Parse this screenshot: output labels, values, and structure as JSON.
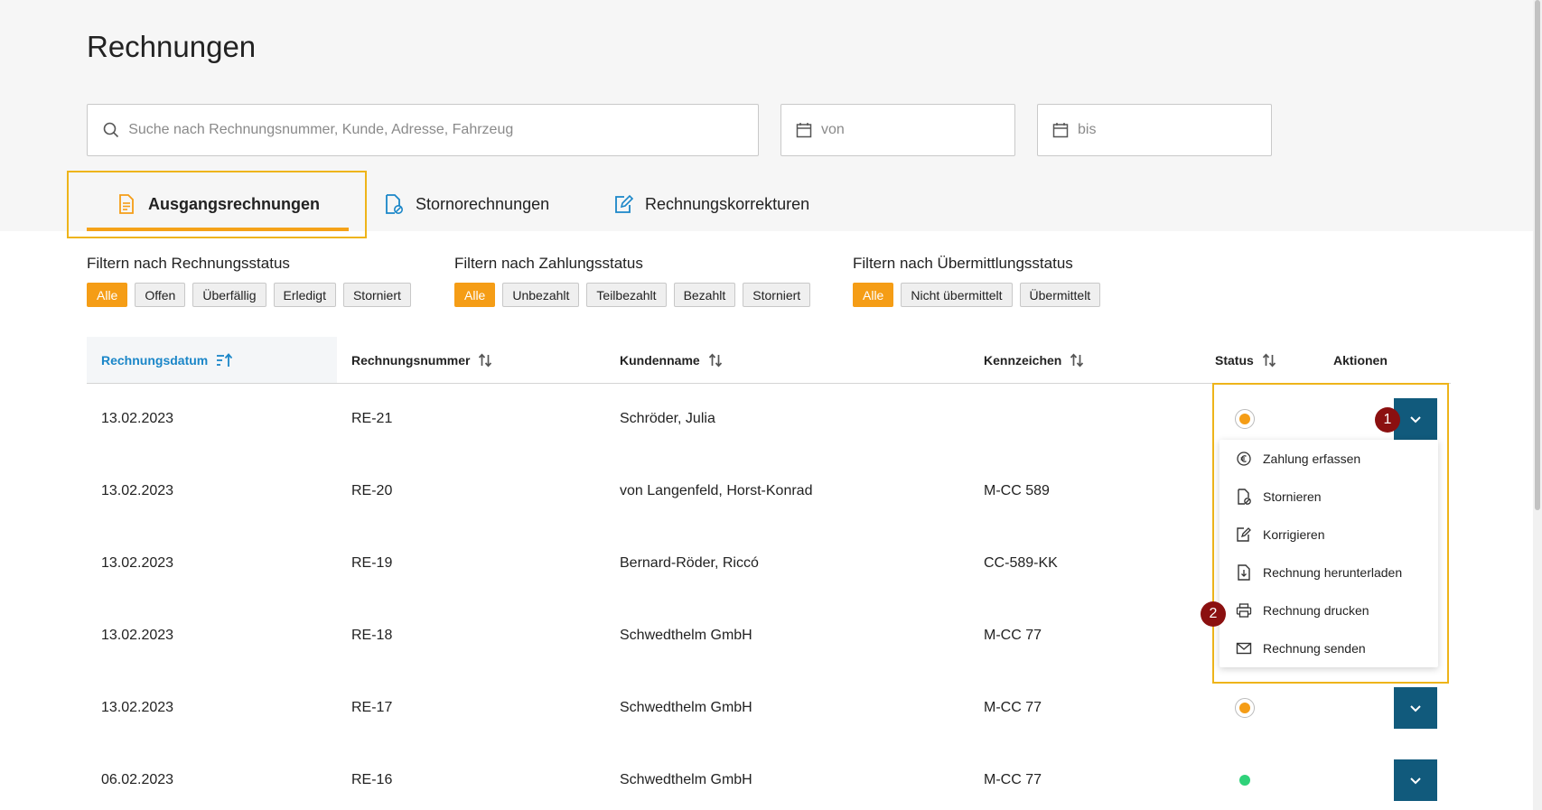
{
  "page": {
    "title": "Rechnungen"
  },
  "search": {
    "placeholder": "Suche nach Rechnungsnummer, Kunde, Adresse, Fahrzeug",
    "date_from_placeholder": "von",
    "date_to_placeholder": "bis"
  },
  "tabs": [
    {
      "label": "Ausgangsrechnungen",
      "icon": "document-icon",
      "active": true
    },
    {
      "label": "Stornorechnungen",
      "icon": "document-cancel-icon",
      "active": false
    },
    {
      "label": "Rechnungskorrekturen",
      "icon": "document-edit-icon",
      "active": false
    }
  ],
  "filters": {
    "rechnungsstatus": {
      "title": "Filtern nach Rechnungsstatus",
      "options": [
        "Alle",
        "Offen",
        "Überfällig",
        "Erledigt",
        "Storniert"
      ],
      "selected": "Alle"
    },
    "zahlungsstatus": {
      "title": "Filtern nach Zahlungsstatus",
      "options": [
        "Alle",
        "Unbezahlt",
        "Teilbezahlt",
        "Bezahlt",
        "Storniert"
      ],
      "selected": "Alle"
    },
    "uebermittlungsstatus": {
      "title": "Filtern nach Übermittlungsstatus",
      "options": [
        "Alle",
        "Nicht übermittelt",
        "Übermittelt"
      ],
      "selected": "Alle"
    }
  },
  "table": {
    "columns": [
      "Rechnungsdatum",
      "Rechnungsnummer",
      "Kundenname",
      "Kennzeichen",
      "Status",
      "Aktionen"
    ],
    "rows": [
      {
        "datum": "13.02.2023",
        "nummer": "RE-21",
        "kunde": "Schröder, Julia",
        "kennzeichen": "",
        "status": "open"
      },
      {
        "datum": "13.02.2023",
        "nummer": "RE-20",
        "kunde": "von Langenfeld, Horst-Konrad",
        "kennzeichen": "M-CC 589",
        "status": "open"
      },
      {
        "datum": "13.02.2023",
        "nummer": "RE-19",
        "kunde": "Bernard-Röder, Riccó",
        "kennzeichen": "CC-589-KK",
        "status": "open"
      },
      {
        "datum": "13.02.2023",
        "nummer": "RE-18",
        "kunde": "Schwedthelm GmbH",
        "kennzeichen": "M-CC 77",
        "status": "open"
      },
      {
        "datum": "13.02.2023",
        "nummer": "RE-17",
        "kunde": "Schwedthelm GmbH",
        "kennzeichen": "M-CC 77",
        "status": "open"
      },
      {
        "datum": "06.02.2023",
        "nummer": "RE-16",
        "kunde": "Schwedthelm GmbH",
        "kennzeichen": "M-CC 77",
        "status": "paid"
      }
    ]
  },
  "action_menu": {
    "items": [
      {
        "label": "Zahlung erfassen",
        "icon": "euro-icon"
      },
      {
        "label": "Stornieren",
        "icon": "document-cancel-icon"
      },
      {
        "label": "Korrigieren",
        "icon": "document-edit-icon"
      },
      {
        "label": "Rechnung herunterladen",
        "icon": "download-icon"
      },
      {
        "label": "Rechnung drucken",
        "icon": "printer-icon"
      },
      {
        "label": "Rechnung senden",
        "icon": "mail-icon"
      }
    ]
  },
  "step_badges": [
    "1",
    "2"
  ],
  "colors": {
    "accent": "#f59d16",
    "action_button": "#115a7c",
    "sorted_header": "#1a86c8",
    "status_paid": "#2fd27a",
    "step_badge": "#8b1010"
  }
}
